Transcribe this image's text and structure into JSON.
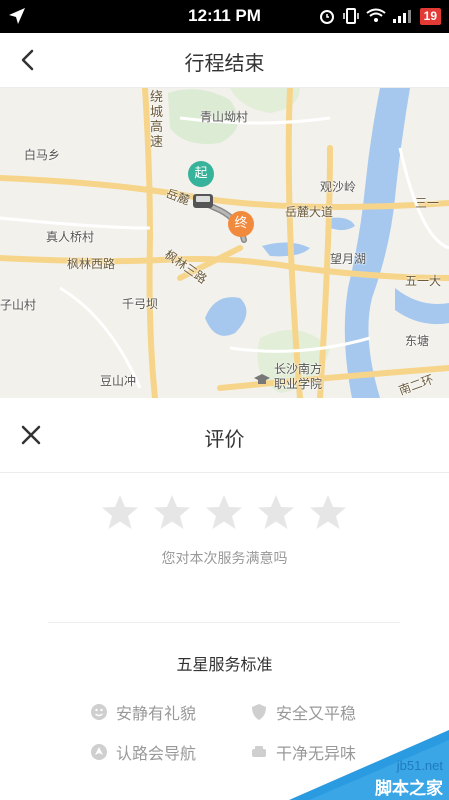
{
  "status_bar": {
    "time": "12:11 PM",
    "battery": "19"
  },
  "header": {
    "title": "行程结束"
  },
  "map": {
    "labels": {
      "qingshan": "青山坳村",
      "baima": "白马乡",
      "guancha": "观沙岭",
      "yuelu_dadao": "岳麓大道",
      "yuelu_road_fragment": "岳麓",
      "sanyi": "三一",
      "zhenren": "真人桥村",
      "fenglin_west": "枫林西路",
      "fenglin_three": "枫林三路",
      "wangyue": "望月湖",
      "wuyi": "五一大",
      "zishan": "子山村",
      "qiangong": "千弓坝",
      "dongtang": "东塘",
      "doushan": "豆山冲",
      "changsha_south": "长沙南方\n职业学院",
      "second_ring": "南二环",
      "ring_road": "绕城高速",
      "sha": "沙"
    },
    "start_marker": "起",
    "end_marker": "终"
  },
  "rating": {
    "title": "评价",
    "question": "您对本次服务满意吗",
    "star_count": 5,
    "standard_title": "五星服务标准",
    "tags": [
      "安静有礼貌",
      "安全又平稳",
      "认路会导航",
      "干净无异味"
    ]
  },
  "watermark": {
    "url": "jb51.net",
    "text": "脚本之家"
  },
  "colors": {
    "start": "#38b39b",
    "end": "#f28a3d",
    "star": "#e6e6e6",
    "text_muted": "#999999"
  }
}
